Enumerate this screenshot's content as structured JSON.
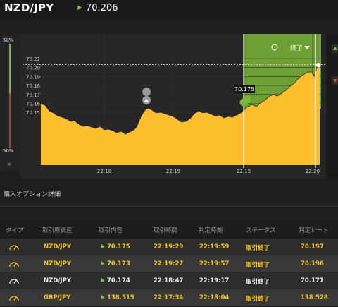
{
  "header": {
    "pair": "NZD/JPY",
    "price": "70.206"
  },
  "gauge": {
    "top_pct": "50%",
    "bottom_pct": "50%",
    "close": "×"
  },
  "chart": {
    "end_label": "終了",
    "entry_tag": "70.175",
    "y_ticks": [
      "70.21",
      "70.20",
      "70.19",
      "70.18",
      "70.17",
      "70.16",
      "70.15"
    ],
    "x_ticks": [
      "22:18",
      "22:19",
      "22:19",
      "22:20"
    ],
    "colors": {
      "area": "#fdbf2d",
      "green_zone": "#6e9f34",
      "bg": "#262626"
    }
  },
  "section": {
    "title": "購入オプション詳細"
  },
  "table": {
    "headers": [
      "タイプ",
      "取引原資産",
      "取引内容",
      "取引時間",
      "判定時刻",
      "ステータス",
      "判定レート"
    ],
    "rows": [
      {
        "asset": "NZD/JPY",
        "content": "70.175",
        "time": "22:19:29",
        "judge": "22:19:59",
        "status": "取引終了",
        "rate": "70.197"
      },
      {
        "asset": "NZD/JPY",
        "content": "70.173",
        "time": "22:19:27",
        "judge": "22:19:57",
        "status": "取引終了",
        "rate": "70.196"
      },
      {
        "asset": "NZD/JPY",
        "content": "70.174",
        "time": "22:18:47",
        "judge": "22:19:17",
        "status": "取引終了",
        "rate": "70.171"
      },
      {
        "asset": "GBP/JPY",
        "content": "138.515",
        "time": "22:17:34",
        "judge": "22:18:04",
        "status": "取引終了",
        "rate": "138.528"
      }
    ]
  }
}
